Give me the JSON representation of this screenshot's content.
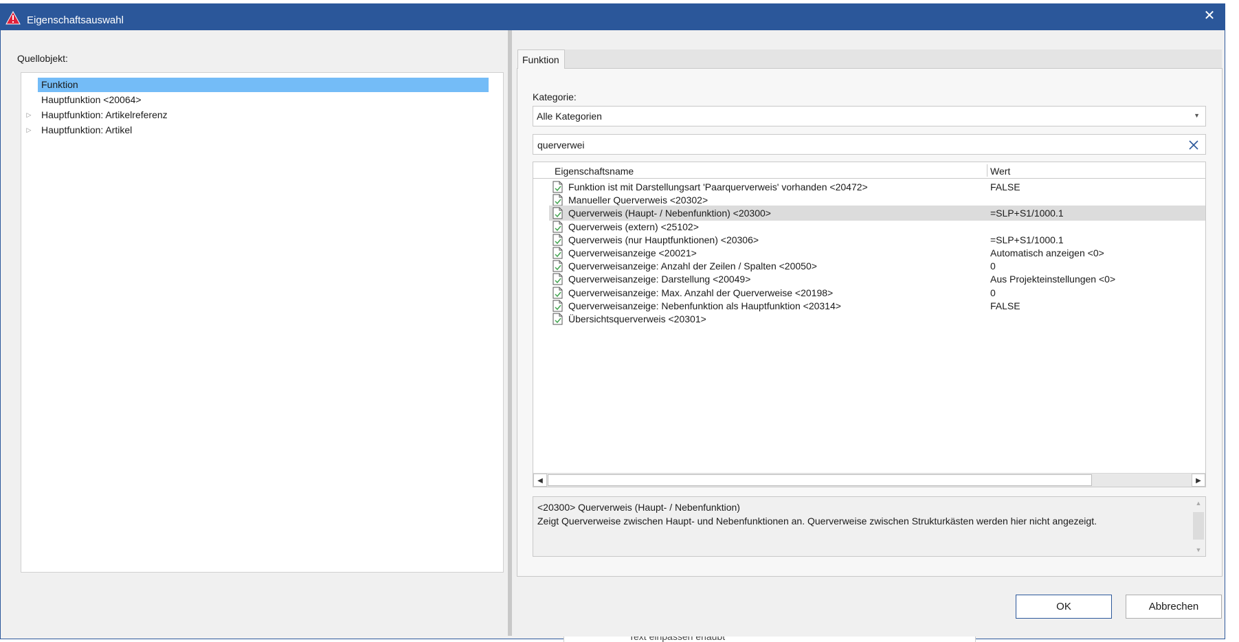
{
  "window": {
    "title": "Eigenschaftsauswahl",
    "close_glyph": "✕"
  },
  "left": {
    "label": "Quellobjekt:",
    "tree": [
      {
        "label": "Funktion",
        "selected": true,
        "expandable": false
      },
      {
        "label": "Hauptfunktion <20064>",
        "selected": false,
        "expandable": false
      },
      {
        "label": "Hauptfunktion: Artikelreferenz",
        "selected": false,
        "expandable": true
      },
      {
        "label": "Hauptfunktion: Artikel",
        "selected": false,
        "expandable": true
      }
    ],
    "expand_glyph": "▷"
  },
  "right": {
    "tab_label": "Funktion",
    "category_label": "Kategorie:",
    "category_value": "Alle Kategorien",
    "search_value": "querverwei",
    "columns": {
      "name": "Eigenschaftsname",
      "value": "Wert"
    },
    "rows": [
      {
        "name": "Funktion ist mit Darstellungsart 'Paarquerverweis' vorhanden <20472>",
        "value": "FALSE"
      },
      {
        "name": "Manueller Querverweis <20302>",
        "value": ""
      },
      {
        "name": "Querverweis (Haupt- / Nebenfunktion) <20300>",
        "value": "=SLP+S1/1000.1"
      },
      {
        "name": "Querverweis (extern) <25102>",
        "value": ""
      },
      {
        "name": "Querverweis (nur Hauptfunktionen) <20306>",
        "value": "=SLP+S1/1000.1"
      },
      {
        "name": "Querverweisanzeige <20021>",
        "value": "Automatisch anzeigen <0>"
      },
      {
        "name": "Querverweisanzeige: Anzahl der Zeilen / Spalten <20050>",
        "value": "0"
      },
      {
        "name": "Querverweisanzeige: Darstellung <20049>",
        "value": "Aus Projekteinstellungen <0>"
      },
      {
        "name": "Querverweisanzeige: Max. Anzahl der Querverweise <20198>",
        "value": "0"
      },
      {
        "name": "Querverweisanzeige: Nebenfunktion als Hauptfunktion <20314>",
        "value": "FALSE"
      },
      {
        "name": "Übersichtsquerverweis <20301>",
        "value": ""
      }
    ],
    "highlighted_row": 2,
    "description_title": "<20300> Querverweis (Haupt- / Nebenfunktion)",
    "description_text": "Zeigt Querverweise zwischen Haupt- und Nebenfunktionen an. Querverweise zwischen Strukturkästen werden hier nicht angezeigt."
  },
  "buttons": {
    "ok": "OK",
    "cancel": "Abbrechen"
  },
  "behind_text": "Text einpassen erlaubt",
  "colors": {
    "titlebar": "#2b579a",
    "selection": "#74bcf7",
    "row_highlight": "#dcdcdc",
    "check": "#3fa34d"
  }
}
